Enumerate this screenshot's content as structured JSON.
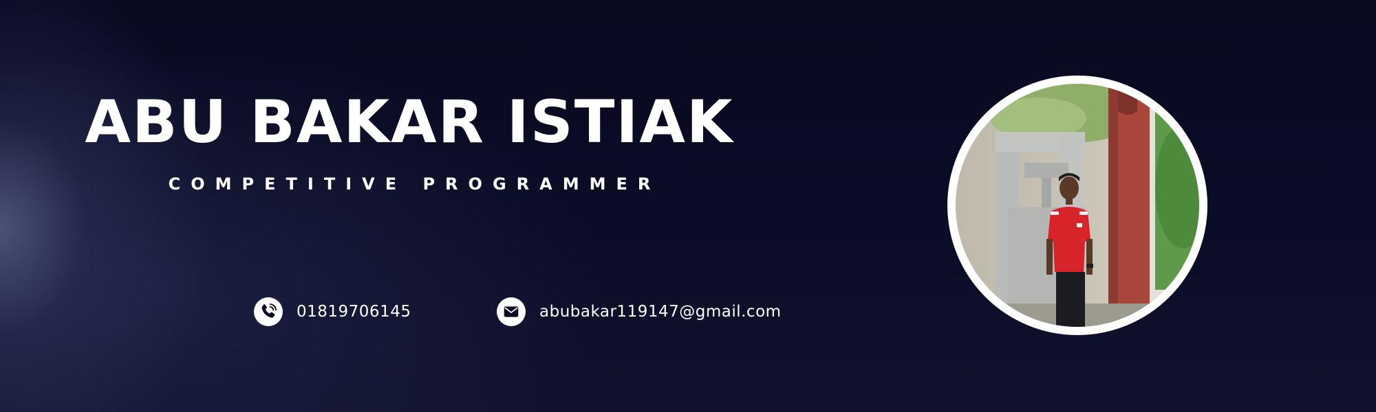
{
  "profile": {
    "name": "ABU BAKAR ISTIAK",
    "role": "COMPETITIVE PROGRAMMER"
  },
  "contacts": {
    "phone": {
      "icon": "phone-icon",
      "text": "01819706145"
    },
    "email": {
      "icon": "mail-icon",
      "text": "abubakar119147@gmail.com"
    }
  },
  "colors": {
    "background": "#0b0c24",
    "text": "#ffffff",
    "ring": "#ffffff",
    "shirt": "#d8232a",
    "brick": "#a8463a"
  }
}
